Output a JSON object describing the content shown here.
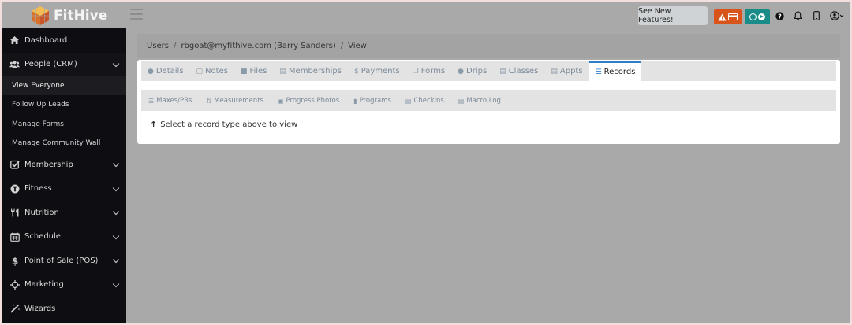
{
  "app": {
    "name": "FitHive",
    "features_label": "See New Features!"
  },
  "sidebar": {
    "items": [
      {
        "label": "Dashboard",
        "icon": "house-icon"
      },
      {
        "label": "People (CRM)",
        "icon": "users-icon"
      },
      {
        "label": "Membership",
        "icon": "check-square-icon"
      },
      {
        "label": "Fitness",
        "icon": "t-circle-icon"
      },
      {
        "label": "Nutrition",
        "icon": "utensils-icon"
      },
      {
        "label": "Schedule",
        "icon": "calendar-icon"
      },
      {
        "label": "Point of Sale (POS)",
        "icon": "dollar-icon"
      },
      {
        "label": "Marketing",
        "icon": "crosshair-icon"
      },
      {
        "label": "Wizards",
        "icon": "wand-icon"
      }
    ],
    "people_sub": [
      "View Everyone",
      "Follow Up Leads",
      "Manage Forms",
      "Manage Community Wall"
    ]
  },
  "breadcrumb": {
    "items": [
      "Users",
      "rbgoat@myfithive.com (Barry Sanders)",
      "View"
    ]
  },
  "tabs": [
    "Details",
    "Notes",
    "Files",
    "Memberships",
    "Payments",
    "Forms",
    "Drips",
    "Classes",
    "Appts",
    "Records"
  ],
  "record_tabs": [
    "Maxes/PRs",
    "Measurements",
    "Progress Photos",
    "Programs",
    "Checkins",
    "Macro Log"
  ],
  "hint": "Select a record type above to view",
  "colors": {
    "alert": "#d9541b",
    "teal": "#198b88",
    "active_tab": "#2d7ec9",
    "sidebar": "#0d0d12"
  }
}
